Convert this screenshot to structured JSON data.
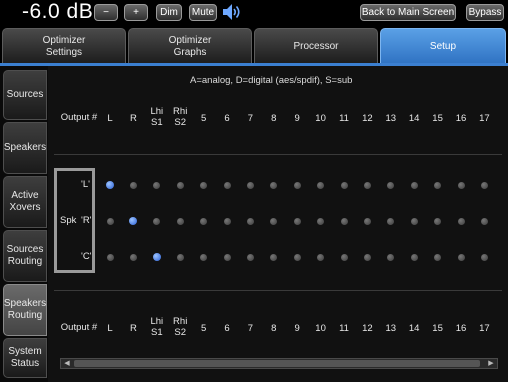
{
  "topbar": {
    "volume": "-6.0 dB",
    "minus_label": "−",
    "plus_label": "+",
    "dim_label": "Dim",
    "mute_label": "Mute",
    "back_label": "Back to Main Screen",
    "bypass_label": "Bypass"
  },
  "tabs": [
    {
      "line1": "Optimizer",
      "line2": "Settings"
    },
    {
      "line1": "Optimizer",
      "line2": "Graphs"
    },
    {
      "line1": "Processor",
      "line2": ""
    },
    {
      "line1": "Setup",
      "line2": ""
    }
  ],
  "active_tab": "Setup",
  "sidebar": [
    {
      "line1": "Sources",
      "line2": ""
    },
    {
      "line1": "Speakers",
      "line2": ""
    },
    {
      "line1": "Active",
      "line2": "Xovers"
    },
    {
      "line1": "Sources",
      "line2": "Routing"
    },
    {
      "line1": "Speakers",
      "line2": "Routing"
    },
    {
      "line1": "System",
      "line2": "Status"
    }
  ],
  "active_sidebar": "Speakers Routing",
  "grid": {
    "legend": "A=analog, D=digital (aes/spdif), S=sub",
    "output_label": "Output #",
    "spk_label": "Spk",
    "columns": [
      {
        "top": "L",
        "bottom": ""
      },
      {
        "top": "R",
        "bottom": ""
      },
      {
        "top": "Lhi",
        "bottom": "S1"
      },
      {
        "top": "Rhi",
        "bottom": "S2"
      },
      {
        "top": "5",
        "bottom": ""
      },
      {
        "top": "6",
        "bottom": ""
      },
      {
        "top": "7",
        "bottom": ""
      },
      {
        "top": "8",
        "bottom": ""
      },
      {
        "top": "9",
        "bottom": ""
      },
      {
        "top": "10",
        "bottom": ""
      },
      {
        "top": "11",
        "bottom": ""
      },
      {
        "top": "12",
        "bottom": ""
      },
      {
        "top": "13",
        "bottom": ""
      },
      {
        "top": "14",
        "bottom": ""
      },
      {
        "top": "15",
        "bottom": ""
      },
      {
        "top": "16",
        "bottom": ""
      },
      {
        "top": "17",
        "bottom": ""
      }
    ],
    "rows": [
      {
        "label": "'L'",
        "active_col": 0
      },
      {
        "label": "'R'",
        "active_col": 1
      },
      {
        "label": "'C'",
        "active_col": 2
      }
    ]
  },
  "colors": {
    "accent": "#3b7fd0",
    "active_dot": "#2a5fd6"
  },
  "icons": {
    "speaker": "speaker-volume-icon",
    "scroll_left": "arrow-left-icon",
    "scroll_right": "arrow-right-icon"
  }
}
